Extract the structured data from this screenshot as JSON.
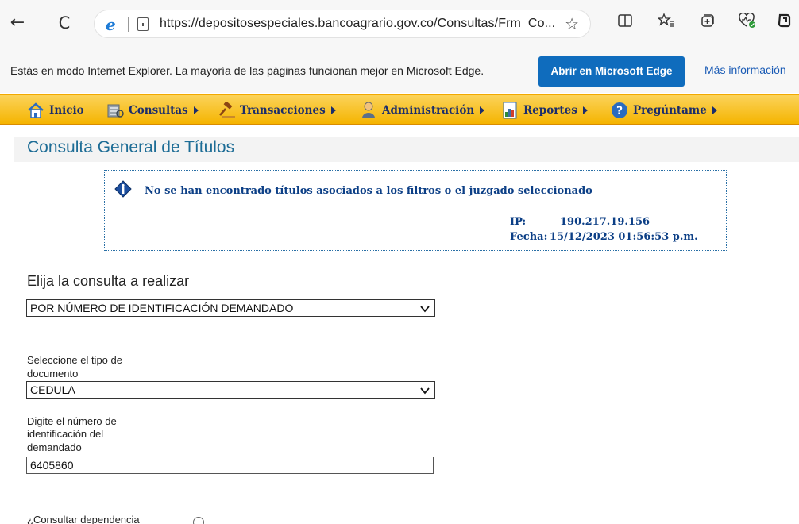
{
  "browser": {
    "back_glyph": "←",
    "refresh_glyph": "C",
    "url": "https://depositosespeciales.bancoagrario.gov.co/Consultas/Frm_Co...",
    "ie_logo": "e",
    "star_glyph": "☆",
    "toolbar_icons": [
      "split-screen-icon",
      "favorites-icon",
      "collections-icon",
      "browser-essentials-icon",
      "copilot-icon"
    ]
  },
  "ie_mode_bar": {
    "message": "Estás en modo Internet Explorer. La mayoría de las páginas funcionan mejor en Microsoft Edge.",
    "open_button": "Abrir en Microsoft Edge",
    "more_info": "Más información"
  },
  "menu": {
    "items": [
      {
        "label": "Inicio",
        "icon": "home-icon"
      },
      {
        "label": "Consultas",
        "icon": "database-icon"
      },
      {
        "label": "Transacciones",
        "icon": "gavel-icon"
      },
      {
        "label": "Administración",
        "icon": "user-icon"
      },
      {
        "label": "Reportes",
        "icon": "report-icon"
      },
      {
        "label": "Pregúntame",
        "icon": "help-icon"
      }
    ]
  },
  "page": {
    "title": "Consulta General de Títulos",
    "info": {
      "message": "No se han encontrado títulos asociados a los filtros o el juzgado seleccionado",
      "ip_label": "IP:",
      "ip_value": "190.217.19.156",
      "date_label": "Fecha:",
      "date_value": "15/12/2023 01:56:53 p.m."
    },
    "section_title": "Elija la consulta a realizar",
    "query_type": "POR NÚMERO DE IDENTIFICACIÓN DEMANDADO",
    "doc_type_label_1": "Seleccione el tipo de",
    "doc_type_label_2": "documento",
    "doc_type": "CEDULA",
    "id_label_1": "Digite el número de",
    "id_label_2": "identificación del",
    "id_label_3": "demandado",
    "id_value": "6405860",
    "dependency_label": "¿Consultar dependencia"
  },
  "colors": {
    "menu_bg": "#f5b400",
    "title_blue": "#1e6d96",
    "info_text": "#0c3f86",
    "edge_button": "#0f6cbd"
  }
}
